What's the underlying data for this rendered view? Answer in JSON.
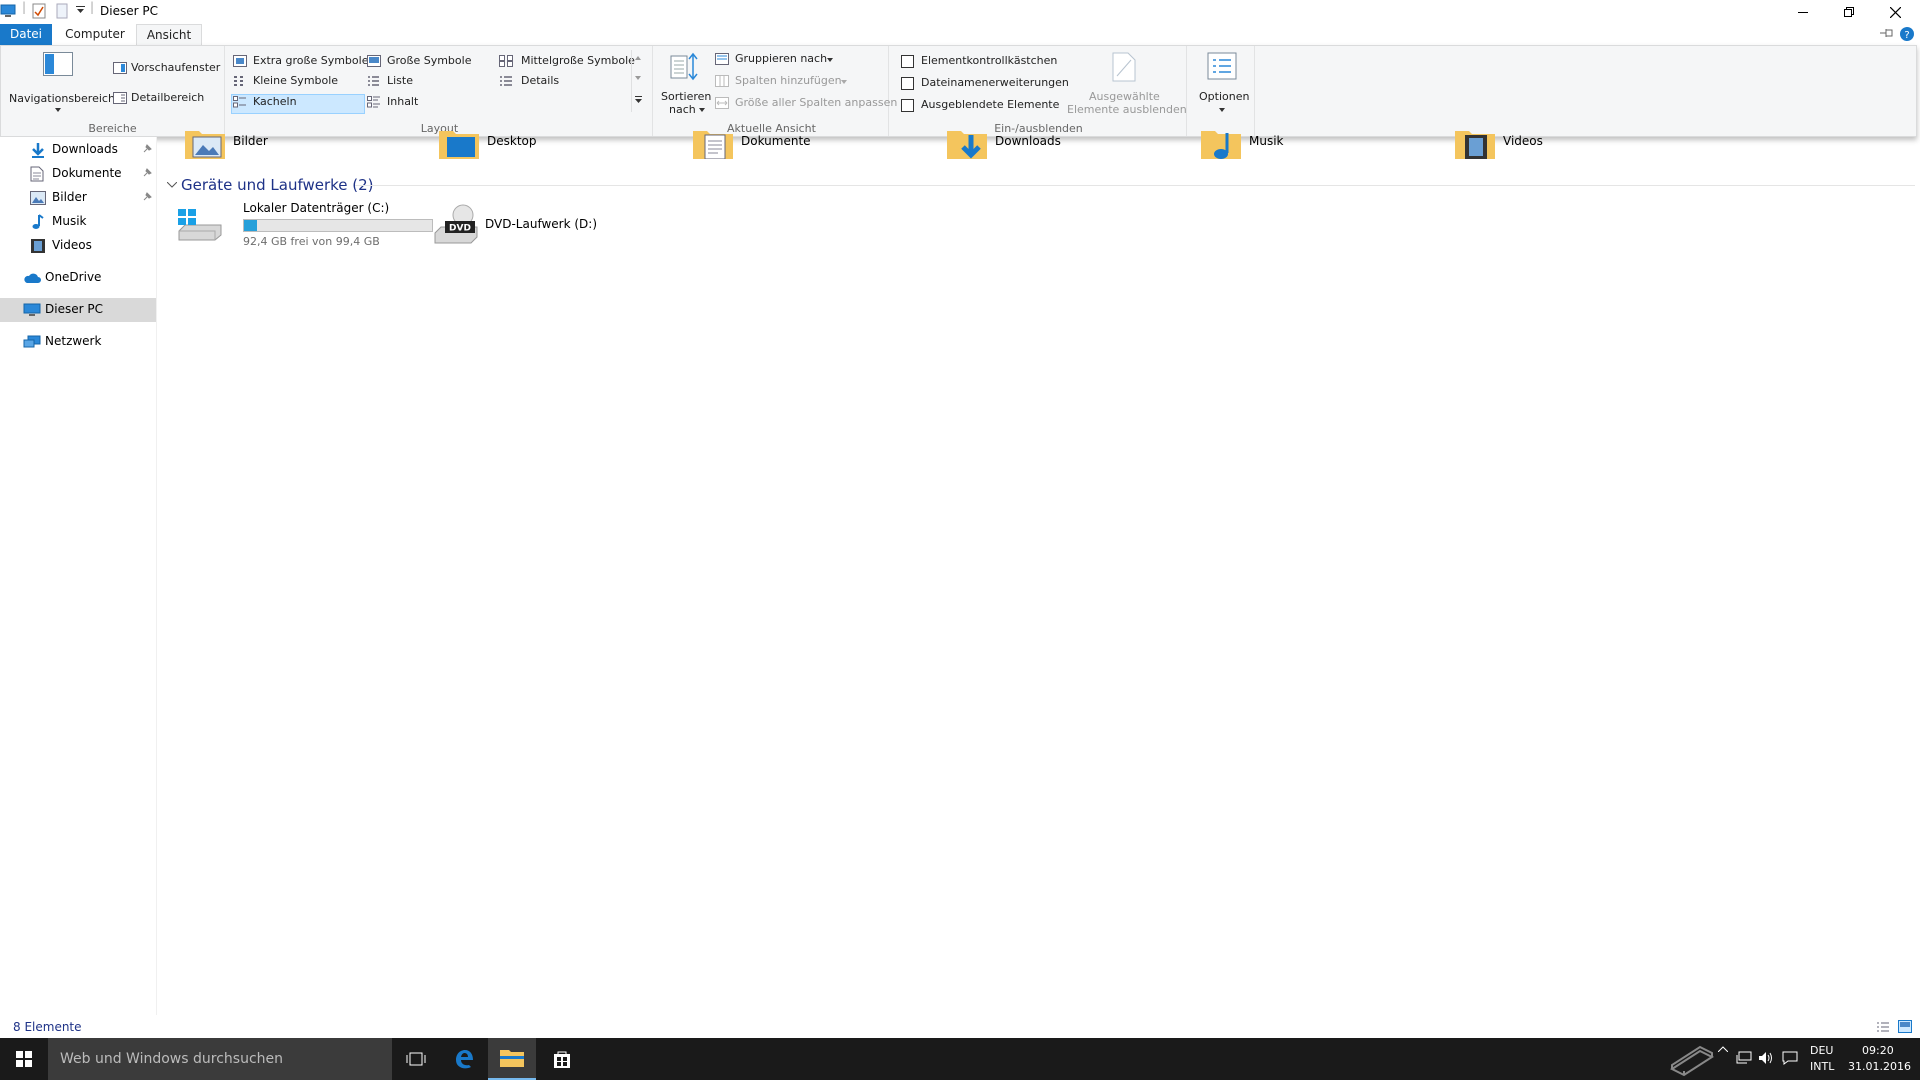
{
  "window": {
    "title": "Dieser PC"
  },
  "tabs": {
    "datei": "Datei",
    "computer": "Computer",
    "ansicht": "Ansicht"
  },
  "ribbon": {
    "bereiche": {
      "navigationsbereich": "Navigationsbereich",
      "vorschaufenster": "Vorschaufenster",
      "detailbereich": "Detailbereich",
      "label": "Bereiche"
    },
    "layout": {
      "extra_gross": "Extra große Symbole",
      "gross": "Große Symbole",
      "mittelgross": "Mittelgroße Symbole",
      "klein": "Kleine Symbole",
      "liste": "Liste",
      "details": "Details",
      "kacheln": "Kacheln",
      "inhalt": "Inhalt",
      "label": "Layout",
      "selected": "Kacheln"
    },
    "aktuelle_ansicht": {
      "sortieren_1": "Sortieren",
      "sortieren_2": "nach",
      "gruppieren": "Gruppieren nach",
      "spalten_hinzufuegen": "Spalten hinzufügen",
      "groesse_spalten": "Größe aller Spalten anpassen",
      "label": "Aktuelle Ansicht"
    },
    "ein_ausblenden": {
      "elementkontrollkaestchen": "Elementkontrollkästchen",
      "dateinamenerweiterungen": "Dateinamenerweiterungen",
      "ausgeblendete_elemente": "Ausgeblendete Elemente",
      "ausgewaehlte_1": "Ausgewählte",
      "ausgewaehlte_2": "Elemente ausblenden",
      "label": "Ein-/ausblenden"
    },
    "optionen": {
      "label": "Optionen"
    }
  },
  "navigation": {
    "items": [
      {
        "label": "Downloads",
        "icon": "download-arrow-icon",
        "pinned": true
      },
      {
        "label": "Dokumente",
        "icon": "document-icon",
        "pinned": true
      },
      {
        "label": "Bilder",
        "icon": "picture-icon",
        "pinned": true
      },
      {
        "label": "Musik",
        "icon": "music-note-icon",
        "pinned": false
      },
      {
        "label": "Videos",
        "icon": "film-icon",
        "pinned": false
      },
      {
        "label": "OneDrive",
        "icon": "cloud-icon",
        "pinned": false
      },
      {
        "label": "Dieser PC",
        "icon": "computer-icon",
        "pinned": false,
        "selected": true
      },
      {
        "label": "Netzwerk",
        "icon": "network-icon",
        "pinned": false
      }
    ]
  },
  "content": {
    "folders": [
      "Bilder",
      "Desktop",
      "Dokumente",
      "Downloads",
      "Musik",
      "Videos"
    ],
    "devices_header": "Geräte und Laufwerke (2)",
    "drives": [
      {
        "name": "Lokaler Datenträger (C:)",
        "detail": "92,4 GB frei von 99,4 GB",
        "used_fraction": 0.07
      },
      {
        "name": "DVD-Laufwerk (D:)",
        "badge": "DVD"
      }
    ]
  },
  "statusbar": {
    "count": "8 Elemente"
  },
  "taskbar": {
    "search_placeholder": "Web und Windows durchsuchen",
    "lang_1": "DEU",
    "lang_2": "INTL",
    "time": "09:20",
    "date": "31.01.2016"
  },
  "colors": {
    "accent": "#1979ca",
    "taskbar": "#1a1a1a",
    "selection": "#cce8ff",
    "folder": "#f4c55d"
  }
}
